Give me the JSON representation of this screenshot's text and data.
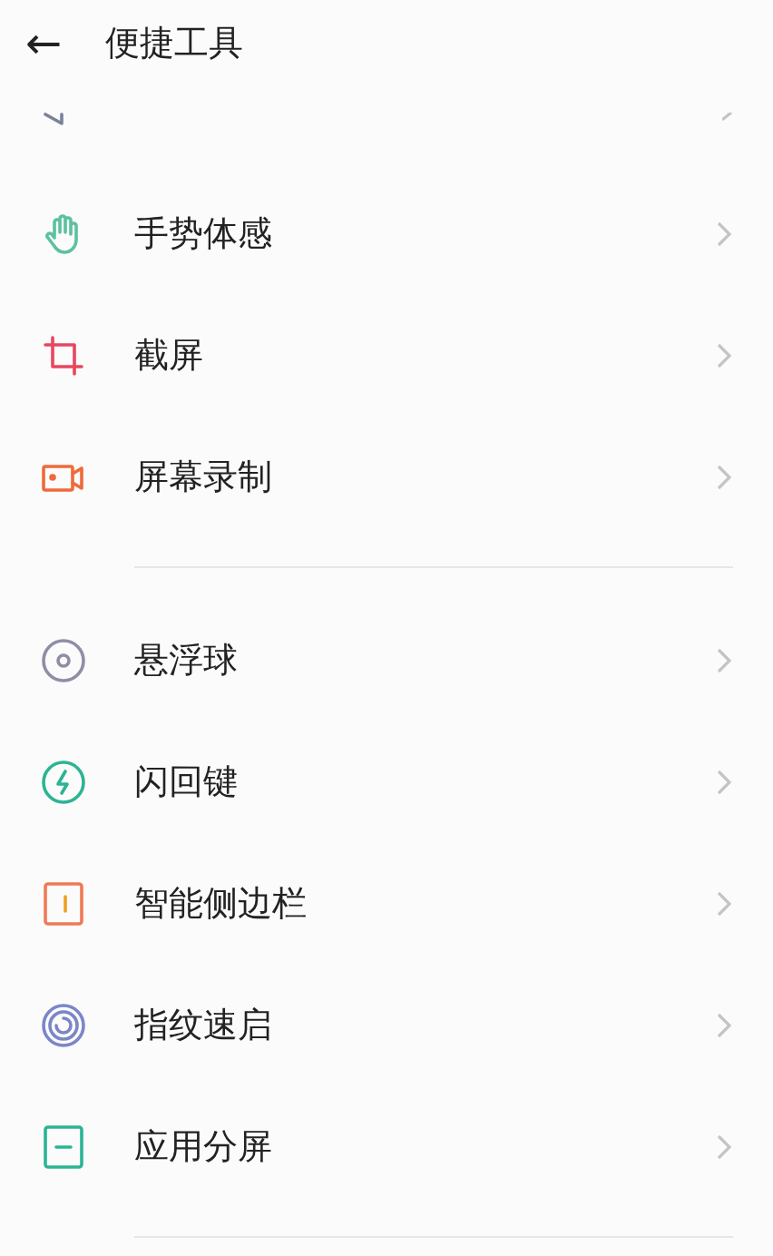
{
  "header": {
    "back": "←",
    "title": "便捷工具"
  },
  "sections": [
    {
      "items": [
        {
          "label": "手势体感"
        },
        {
          "label": "截屏"
        },
        {
          "label": "屏幕录制"
        }
      ]
    },
    {
      "items": [
        {
          "label": "悬浮球"
        },
        {
          "label": "闪回键"
        },
        {
          "label": "智能侧边栏"
        },
        {
          "label": "指纹速启"
        },
        {
          "label": "应用分屏"
        }
      ]
    }
  ]
}
